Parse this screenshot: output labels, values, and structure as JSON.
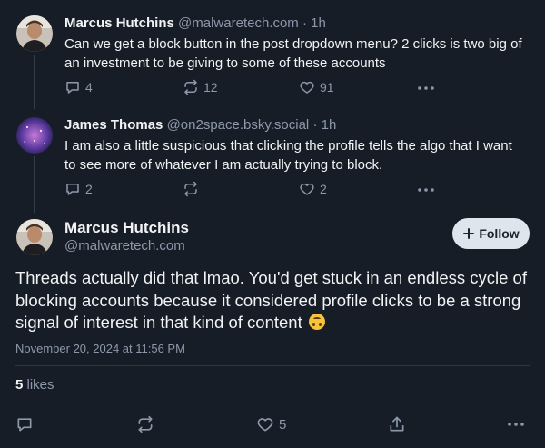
{
  "replies": [
    {
      "author": "Marcus Hutchins",
      "handle": "@malwaretech.com",
      "separator": "·",
      "time": "1h",
      "text": "Can we get a block button in the post dropdown menu? 2 clicks is two big of an investment to be giving to some of these accounts",
      "reply_count": "4",
      "repost_count": "12",
      "like_count": "91"
    },
    {
      "author": "James Thomas",
      "handle": "@on2space.bsky.social",
      "separator": "·",
      "time": "1h",
      "text": "I am also a little suspicious that clicking the profile tells the algo that I want to see more of whatever I am actually trying to block.",
      "reply_count": "2",
      "repost_count": "",
      "like_count": "2"
    }
  ],
  "main_post": {
    "author": "Marcus Hutchins",
    "handle": "@malwaretech.com",
    "follow_label": "Follow",
    "text": "Threads actually did that lmao. You'd get stuck in an endless cycle of blocking accounts because it considered profile clicks to be a strong signal of interest in that kind of content",
    "timestamp": "November 20, 2024 at 11:56 PM",
    "likes_count": "5",
    "likes_label": "likes",
    "like_count": "5"
  },
  "icons": {
    "reply": "reply-icon",
    "repost": "repost-icon",
    "like": "heart-icon",
    "more": "more-icon",
    "share": "share-icon",
    "follow": "plus-icon",
    "emoji": "upside-down-face-emoji"
  },
  "colors": {
    "background": "#171d26",
    "muted": "#8d99ab",
    "follow_bg": "#dfe5ec"
  }
}
